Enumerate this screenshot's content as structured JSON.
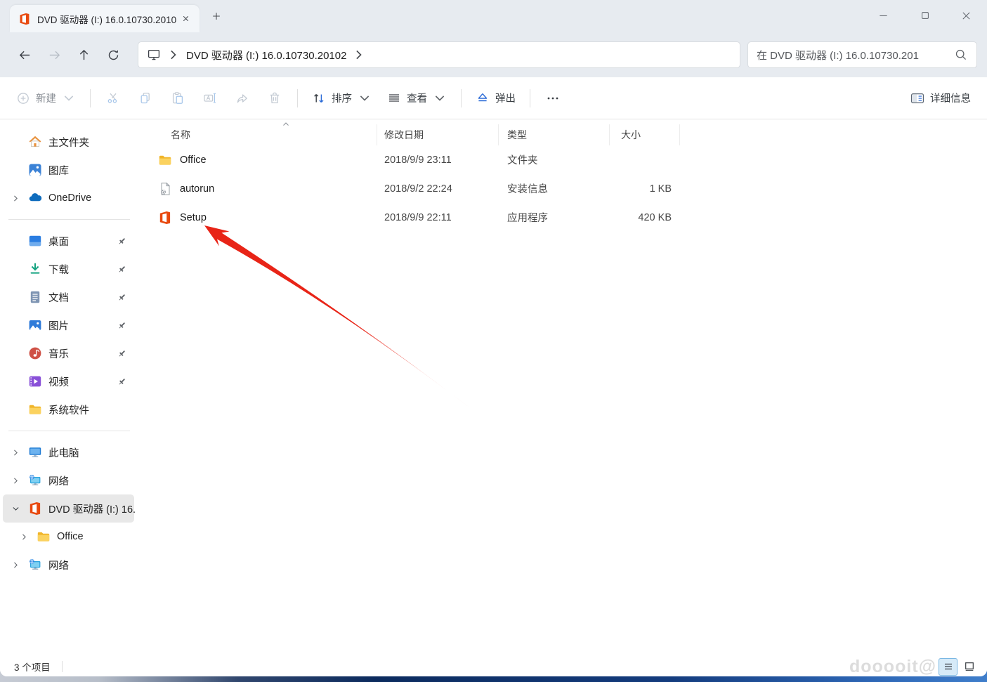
{
  "titlebar": {
    "tab_title": "DVD 驱动器 (I:) 16.0.10730.2010"
  },
  "navbar": {
    "path": "DVD 驱动器 (I:) 16.0.10730.20102",
    "search_value": "在 DVD 驱动器 (I:) 16.0.10730.201"
  },
  "toolbar": {
    "new_label": "新建",
    "sort_label": "排序",
    "view_label": "查看",
    "eject_label": "弹出",
    "details_label": "详细信息"
  },
  "sidebar": {
    "sections": [
      {
        "items": [
          {
            "label": "主文件夹",
            "icon": "home-icon"
          },
          {
            "label": "图库",
            "icon": "gallery-icon"
          },
          {
            "label": "OneDrive",
            "icon": "onedrive-icon",
            "expand": "collapsed"
          }
        ]
      },
      {
        "items": [
          {
            "label": "桌面",
            "icon": "desktop-icon",
            "pinned": true
          },
          {
            "label": "下载",
            "icon": "downloads-icon",
            "pinned": true
          },
          {
            "label": "文档",
            "icon": "documents-icon",
            "pinned": true
          },
          {
            "label": "图片",
            "icon": "pictures-icon",
            "pinned": true
          },
          {
            "label": "音乐",
            "icon": "music-icon",
            "pinned": true
          },
          {
            "label": "视频",
            "icon": "videos-icon",
            "pinned": true
          },
          {
            "label": "系统软件",
            "icon": "folder-icon"
          }
        ]
      },
      {
        "items": [
          {
            "label": "此电脑",
            "icon": "thispc-icon",
            "expand": "collapsed"
          },
          {
            "label": "网络",
            "icon": "network-icon",
            "expand": "collapsed"
          },
          {
            "label": "DVD 驱动器 (I:) 16.",
            "icon": "office-disc-icon",
            "expand": "expanded",
            "selected": true
          },
          {
            "label": "Office",
            "icon": "folder-icon",
            "expand": "collapsed",
            "indent": 1
          },
          {
            "label": "网络",
            "icon": "network-icon",
            "expand": "collapsed"
          }
        ]
      }
    ]
  },
  "filelist": {
    "columns": [
      "名称",
      "修改日期",
      "类型",
      "大小"
    ],
    "rows": [
      {
        "name": "Office",
        "icon": "folder-icon",
        "date": "2018/9/9 23:11",
        "type": "文件夹",
        "size": ""
      },
      {
        "name": "autorun",
        "icon": "autorun-icon",
        "date": "2018/9/2 22:24",
        "type": "安装信息",
        "size": "1 KB"
      },
      {
        "name": "Setup",
        "icon": "office-app-icon",
        "date": "2018/9/9 22:11",
        "type": "应用程序",
        "size": "420 KB"
      }
    ]
  },
  "statusbar": {
    "count": "3 个项目",
    "watermark": "dooooit@"
  },
  "colors": {
    "arrow": "#e82417",
    "selection_bg": "#e8e8e8",
    "accent_blue": "#2b6bd7"
  }
}
